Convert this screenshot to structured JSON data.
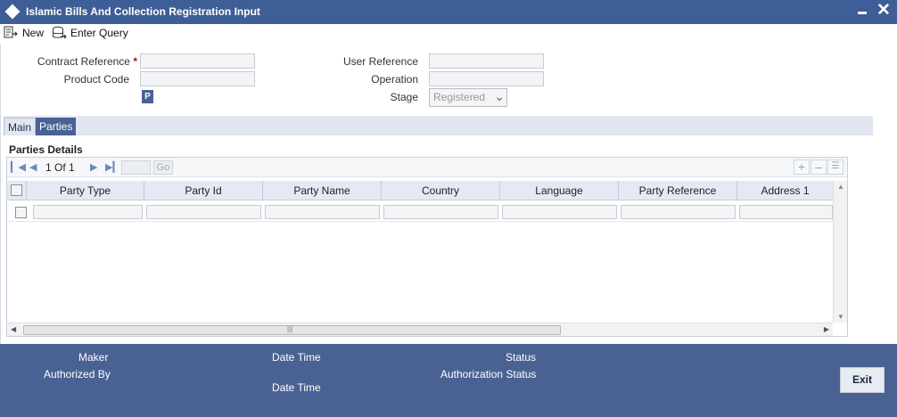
{
  "window": {
    "title": "Islamic Bills And Collection Registration Input",
    "minimize_icon": "minimize-icon",
    "close_label": "✕"
  },
  "toolbar": {
    "new_label": "New",
    "enter_query_label": "Enter Query"
  },
  "form": {
    "contract_reference_label": "Contract Reference",
    "required_mark": "*",
    "product_code_label": "Product Code",
    "p_button_label": "P",
    "user_reference_label": "User Reference",
    "operation_label": "Operation",
    "stage_label": "Stage",
    "stage_value": "Registered"
  },
  "tabs": {
    "main_label": "Main",
    "parties_label": "Parties",
    "active": "Parties"
  },
  "parties": {
    "section_title": "Parties Details",
    "page_info": "1 Of 1",
    "go_label": "Go",
    "columns": [
      "Party Type",
      "Party Id",
      "Party Name",
      "Country",
      "Language",
      "Party Reference",
      "Address 1"
    ]
  },
  "footer": {
    "maker_label": "Maker",
    "date_time_label_1": "Date Time",
    "status_label": "Status",
    "authorized_by_label": "Authorized By",
    "authorization_status_label": "Authorization Status",
    "date_time_label_2": "Date Time",
    "exit_label": "Exit"
  },
  "colors": {
    "title_bar": "#3d5e96",
    "accent": "#4a6293",
    "tab_strip": "#e1e6f0"
  }
}
